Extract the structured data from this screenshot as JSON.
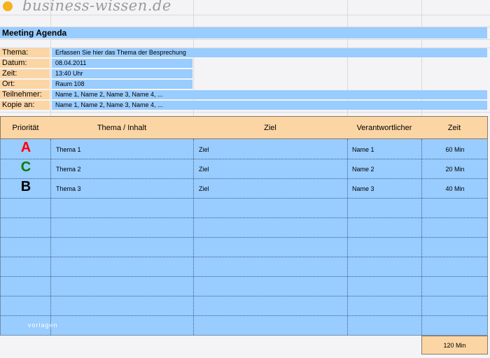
{
  "logo": {
    "text": "business-wissen.de"
  },
  "title": "Meeting Agenda",
  "info": [
    {
      "label": "Thema:",
      "value": "Erfassen Sie hier das Thema der Besprechung"
    },
    {
      "label": "Datum:",
      "value": "08.04.2011"
    },
    {
      "label": "Zeit:",
      "value": "13:40 Uhr"
    },
    {
      "label": "Ort:",
      "value": "Raum 108"
    },
    {
      "label": "Teilnehmer:",
      "value": "Name 1, Name 2, Name 3, Name 4, ..."
    },
    {
      "label": "Kopie an:",
      "value": "Name 1, Name 2, Name 3, Name 4, ..."
    }
  ],
  "table": {
    "headers": [
      "Priorität",
      "Thema / Inhalt",
      "Ziel",
      "Verantwortlicher",
      "Zeit"
    ],
    "rows": [
      {
        "priority": "A",
        "priority_color": "#ff0000",
        "topic": "Thema 1",
        "goal": "Ziel",
        "owner": "Name 1",
        "time": "60 Min"
      },
      {
        "priority": "C",
        "priority_color": "#008000",
        "topic": "Thema 2",
        "goal": "Ziel",
        "owner": "Name 2",
        "time": "20 Min"
      },
      {
        "priority": "B",
        "priority_color": "#000000",
        "topic": "Thema 3",
        "goal": "Ziel",
        "owner": "Name 3",
        "time": "40 Min"
      }
    ],
    "total": "120 Min"
  },
  "watermark": "vorlagen",
  "colors": {
    "label_bg": "#fcd5a4",
    "value_bg": "#99ccff",
    "accent": "#f5b21f"
  }
}
